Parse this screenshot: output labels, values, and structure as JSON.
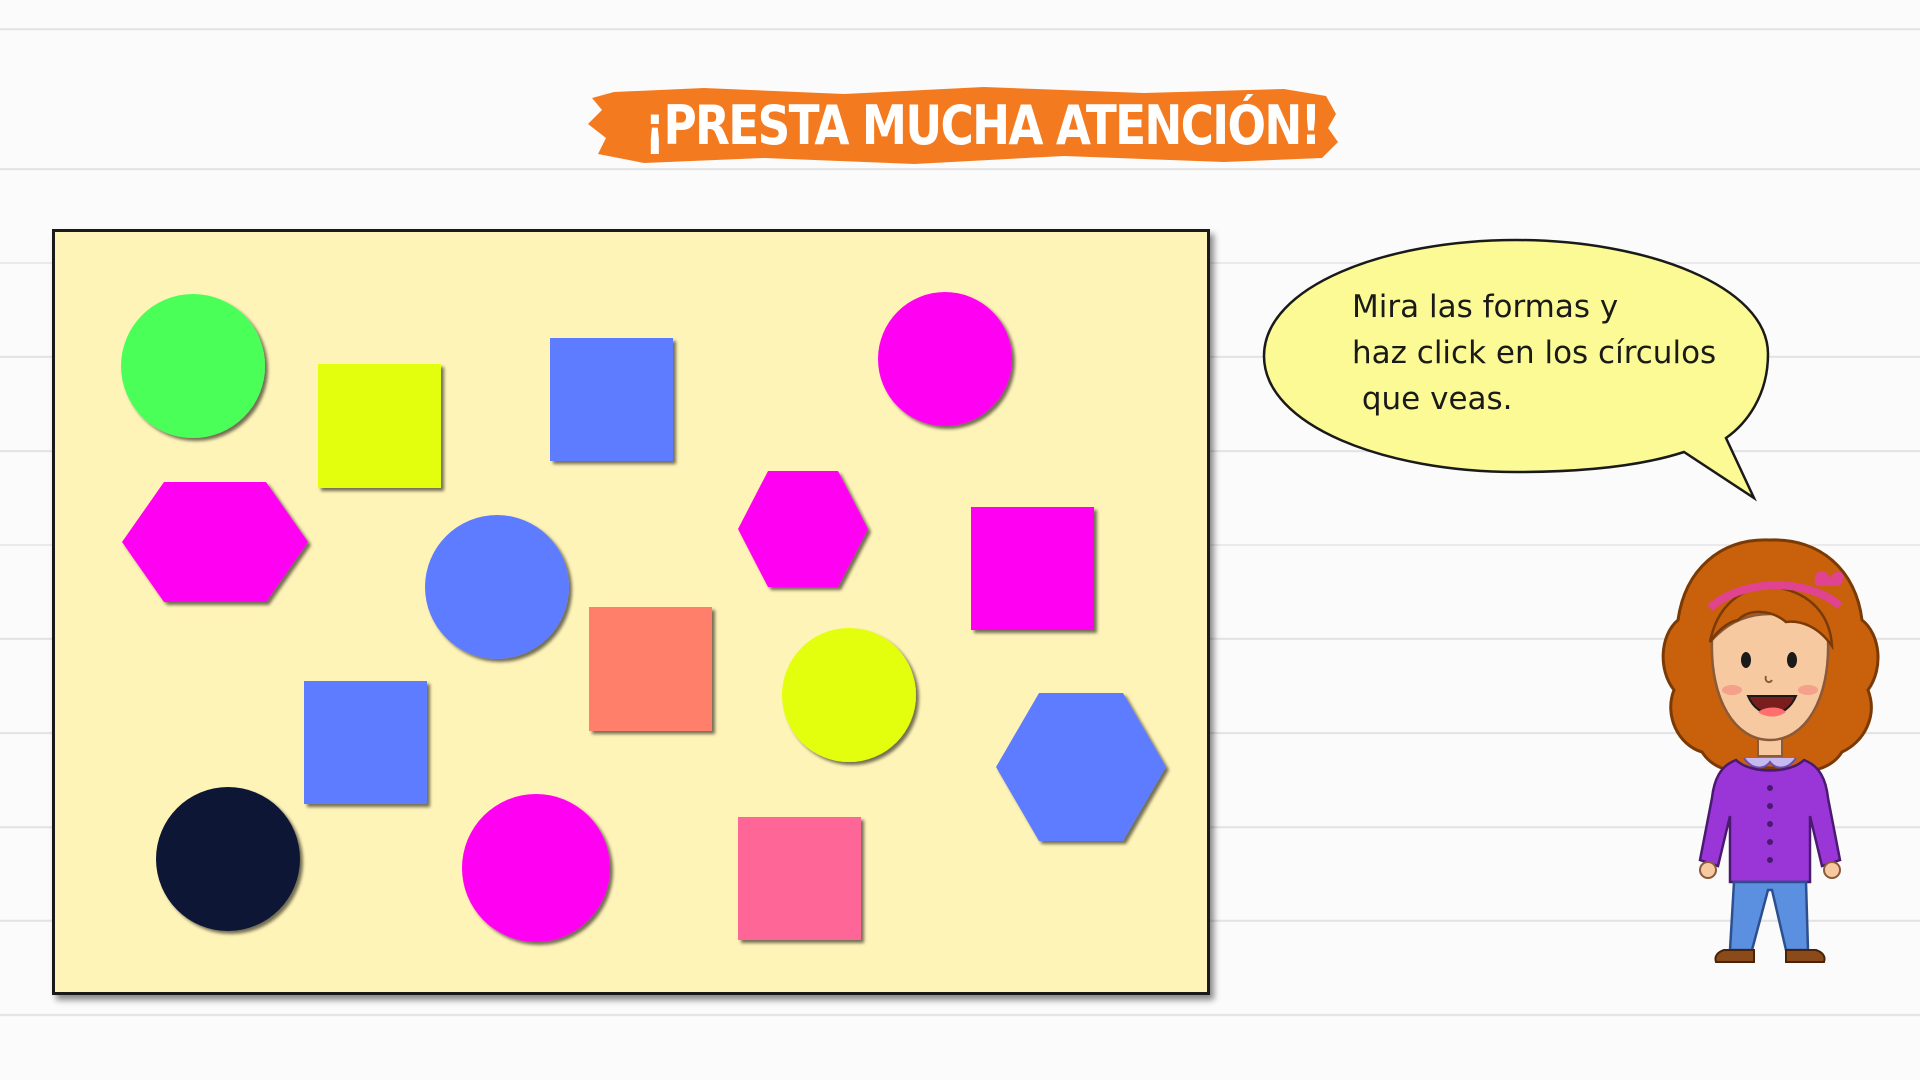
{
  "header": {
    "title": "¡PRESTA MUCHA ATENCIÓN!",
    "banner_color": "#f47a1f",
    "title_color": "#ffffff"
  },
  "speech_bubble": {
    "text": "Mira las formas y\nhaz click en los círculos\n que veas.",
    "fill_color": "#fbfa94"
  },
  "board": {
    "background_color": "#fff4b8",
    "shapes": [
      {
        "name": "circle-green",
        "type": "circle",
        "color": "#48ff58"
      },
      {
        "name": "square-yellow",
        "type": "square",
        "color": "#e3ff08"
      },
      {
        "name": "square-blue-top",
        "type": "square",
        "color": "#5d7bff"
      },
      {
        "name": "circle-magenta-top",
        "type": "circle",
        "color": "#ff00f2"
      },
      {
        "name": "hexagon-magenta-left",
        "type": "hexagon",
        "color": "#ff00f2"
      },
      {
        "name": "circle-blue",
        "type": "circle",
        "color": "#5d7bff"
      },
      {
        "name": "hexagon-magenta-center",
        "type": "hexagon",
        "color": "#ff00f2"
      },
      {
        "name": "square-magenta",
        "type": "square",
        "color": "#ff00f2"
      },
      {
        "name": "square-salmon",
        "type": "square",
        "color": "#ff7f6b"
      },
      {
        "name": "circle-yellow",
        "type": "circle",
        "color": "#e3ff08"
      },
      {
        "name": "square-blue-bottom",
        "type": "square",
        "color": "#5d7bff"
      },
      {
        "name": "hexagon-blue",
        "type": "hexagon",
        "color": "#5d7bff"
      },
      {
        "name": "circle-navy",
        "type": "circle",
        "color": "#0d1535"
      },
      {
        "name": "circle-magenta-bottom",
        "type": "circle",
        "color": "#ff00f2"
      },
      {
        "name": "square-pink",
        "type": "square",
        "color": "#ff6698"
      }
    ]
  },
  "character": {
    "icon": "girl-character-icon",
    "hair_color": "#c8600c",
    "shirt_color": "#9a36d8",
    "pants_color": "#5b8fe0"
  }
}
